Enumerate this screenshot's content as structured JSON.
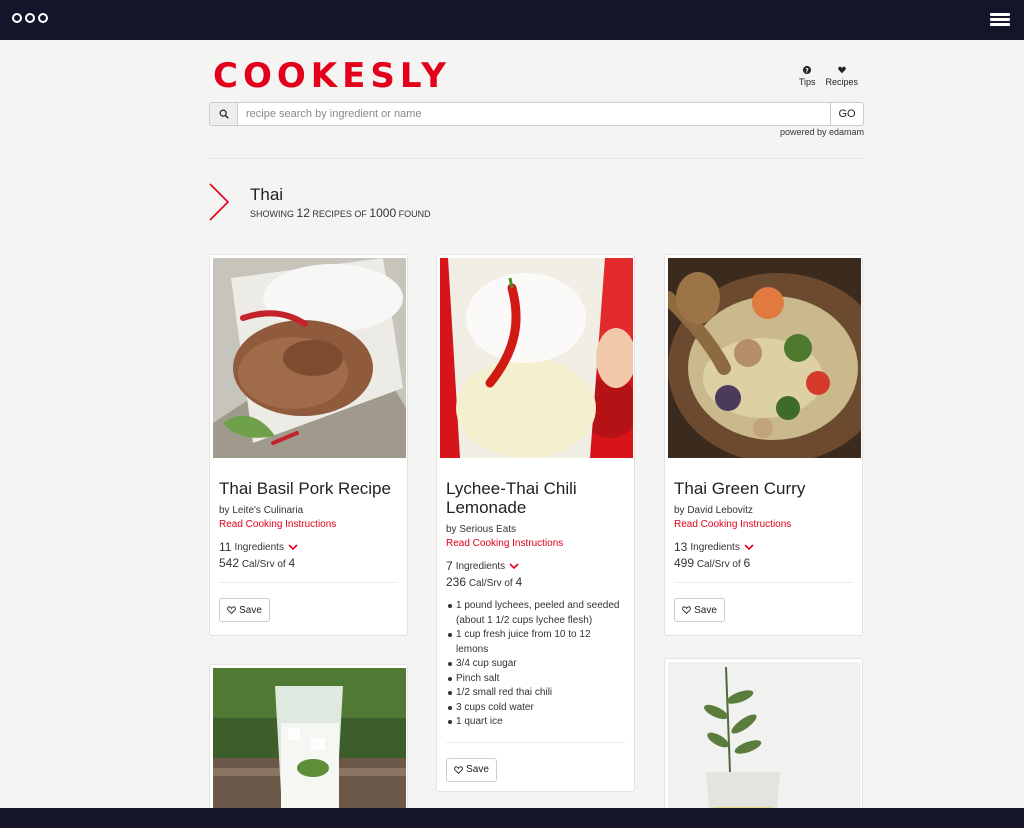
{
  "app": {
    "brand": "COOKESLY",
    "nav": [
      {
        "label": "Tips",
        "icon": "help-icon"
      },
      {
        "label": "Recipes",
        "icon": "heart-icon"
      }
    ],
    "search_placeholder": "recipe search by ingredient or name",
    "go_label": "GO",
    "powered_by": "powered by edamam"
  },
  "results": {
    "query": "Thai",
    "showing_label": "SHOWING",
    "shown": "12",
    "recipes_of_label": "RECIPES OF",
    "total": "1000",
    "found_label": "FOUND"
  },
  "labels": {
    "read": "Read Cooking Instructions",
    "ingredients": "Ingredients",
    "cal_srv": "Cal/Srv of",
    "save": "Save"
  },
  "recipes": [
    {
      "title": "Thai Basil Pork Recipe",
      "by": "by Leite's Culinaria",
      "ingredients": "11",
      "calories": "542",
      "servings": "4"
    },
    {
      "title": "Lychee-Thai Chili Lemonade",
      "by": "by Serious Eats",
      "ingredients": "7",
      "calories": "236",
      "servings": "4",
      "ingredient_list": [
        "1 pound lychees, peeled and seeded (about 1 1/2 cups lychee flesh)",
        "1 cup fresh juice from 10 to 12 lemons",
        "3/4 cup sugar",
        "Pinch salt",
        "1/2 small red thai chili",
        "3 cups cold water",
        "1 quart ice"
      ]
    },
    {
      "title": "Thai Green Curry",
      "by": "by David Lebovitz",
      "ingredients": "13",
      "calories": "499",
      "servings": "6"
    }
  ],
  "colors": {
    "accent": "#e2001a",
    "topbar": "#14142a",
    "background": "#f4f4f3"
  }
}
